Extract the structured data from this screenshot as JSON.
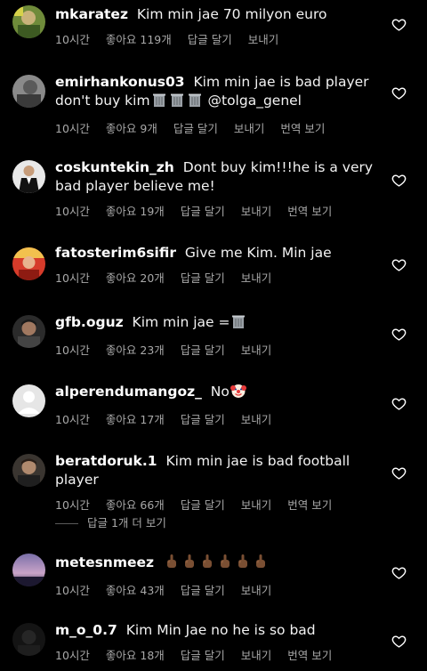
{
  "colors": {
    "background": "#000000",
    "text": "#f2f2f2",
    "meta": "#a8a8a8",
    "icon": "#ffffff"
  },
  "comments": [
    {
      "username": "mkaratez",
      "text": " Kim min jae 70 milyon euro",
      "time": "10시간",
      "likes": "좋아요 119개",
      "reply": "답글 달기",
      "send": "보내기",
      "translate": "",
      "avatar": "yellow-green photo",
      "like_icon": "heart-outline-icon"
    },
    {
      "username": "emirhankonus03",
      "text": " Kim min jae is bad player don't buy kim",
      "emojis": [
        "wastebasket",
        "wastebasket",
        "wastebasket"
      ],
      "after": " @tolga_genel",
      "time": "10시간",
      "likes": "좋아요 9개",
      "reply": "답글 달기",
      "send": "보내기",
      "translate": "번역 보기",
      "avatar": "grey photo",
      "like_icon": "heart-outline-icon"
    },
    {
      "username": "coskuntekin_zh",
      "text": " Dont buy kim!!!he is a very bad player believe me!",
      "time": "10시간",
      "likes": "좋아요 19개",
      "reply": "답글 달기",
      "send": "보내기",
      "translate": "번역 보기",
      "avatar": "person in suit",
      "like_icon": "heart-outline-icon"
    },
    {
      "username": "fatosterim6sifir",
      "text": " Give me Kim. Min jae",
      "time": "10시간",
      "likes": "좋아요 20개",
      "reply": "답글 달기",
      "send": "보내기",
      "translate": "",
      "avatar": "red and yellow",
      "like_icon": "heart-outline-icon"
    },
    {
      "username": "gfb.oguz",
      "text": " Kim min jae =",
      "emojis": [
        "wastebasket"
      ],
      "time": "10시간",
      "likes": "좋아요 23개",
      "reply": "답글 달기",
      "send": "보내기",
      "translate": "",
      "avatar": "dark portrait",
      "like_icon": "heart-outline-icon"
    },
    {
      "username": "alperendumangoz_",
      "text": " No",
      "emojis": [
        "clown"
      ],
      "time": "10시간",
      "likes": "좋아요 17개",
      "reply": "답글 달기",
      "send": "보내기",
      "translate": "",
      "avatar": "default profile",
      "like_icon": "heart-outline-icon"
    },
    {
      "username": "beratdoruk.1",
      "text": " Kim min jae is bad football player",
      "time": "10시간",
      "likes": "좋아요 66개",
      "reply": "답글 달기",
      "send": "보내기",
      "translate": "번역 보기",
      "avatar": "man portrait",
      "like_icon": "heart-outline-icon"
    },
    {
      "username": "metesnmeez",
      "text": " ",
      "emojis": [
        "middle-finger",
        "middle-finger",
        "middle-finger",
        "middle-finger",
        "middle-finger",
        "middle-finger"
      ],
      "time": "10시간",
      "likes": "좋아요 43개",
      "reply": "답글 달기",
      "send": "보내기",
      "translate": "",
      "avatar": "purple sky",
      "like_icon": "heart-outline-icon"
    },
    {
      "username": "m_o_0.7",
      "text": " Kim Min Jae no he is so bad",
      "time": "10시간",
      "likes": "좋아요 18개",
      "reply": "답글 달기",
      "send": "보내기",
      "translate": "번역 보기",
      "avatar": "dark photo",
      "like_icon": "heart-outline-icon"
    }
  ],
  "replies_toggle": "답글 1개 더 보기"
}
